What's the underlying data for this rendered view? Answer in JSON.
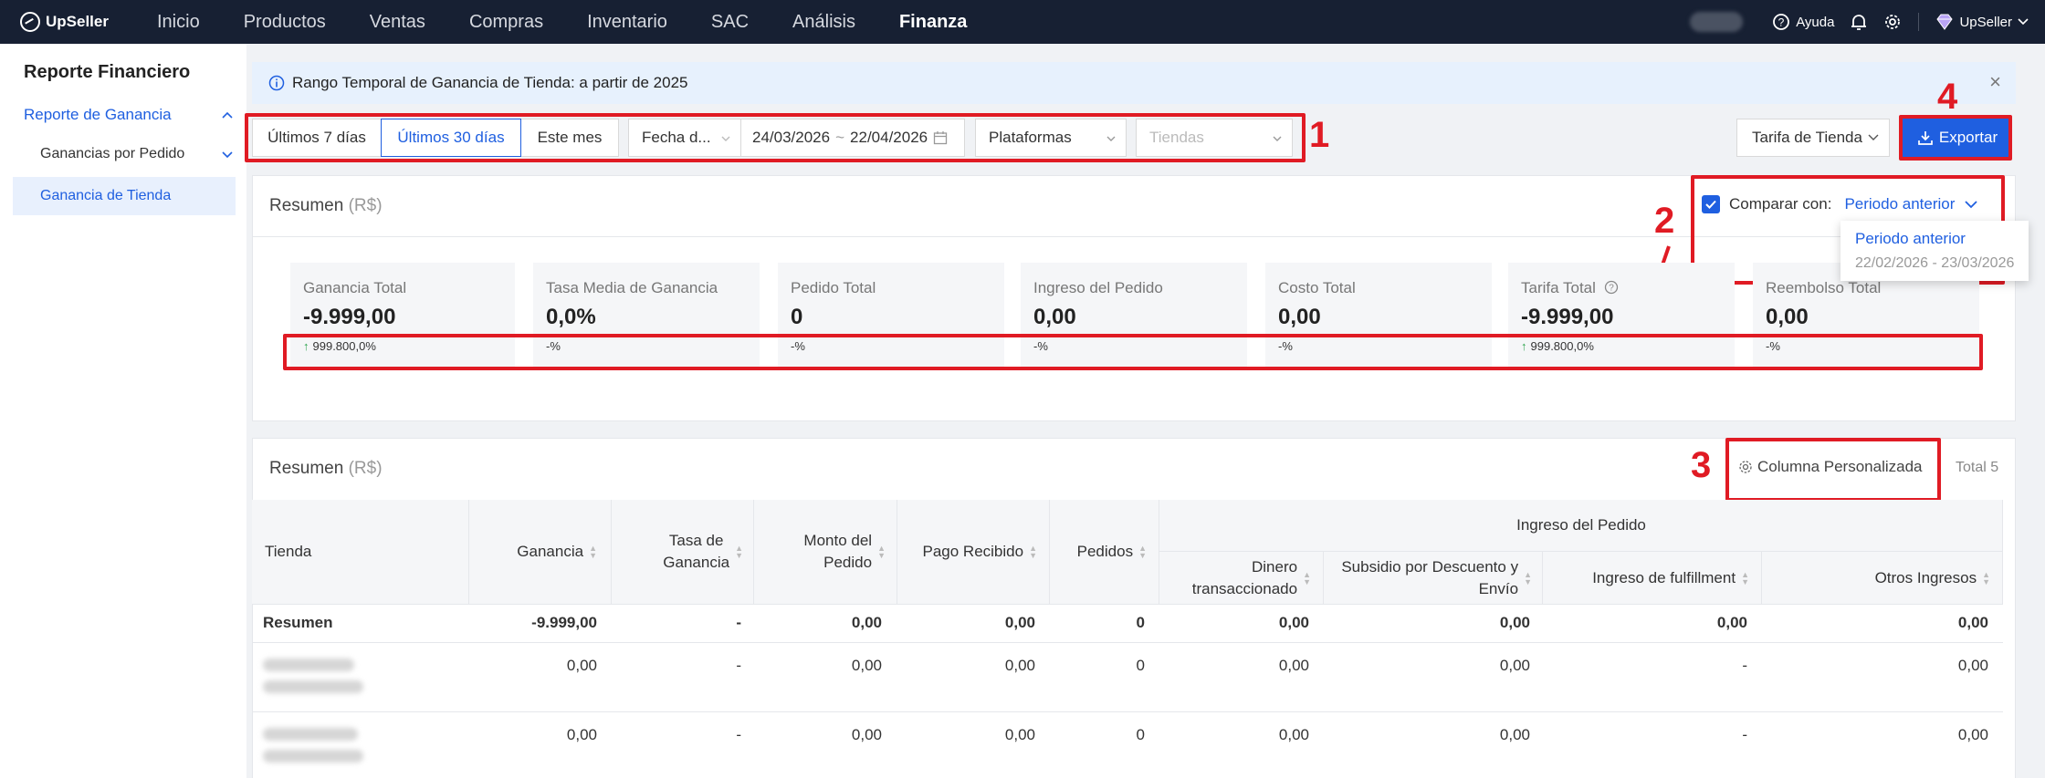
{
  "nav": {
    "brand": "UpSeller",
    "items": [
      "Inicio",
      "Productos",
      "Ventas",
      "Compras",
      "Inventario",
      "SAC",
      "Análisis",
      "Finanza"
    ],
    "active_index": 7,
    "help": "Ayuda",
    "user": "UpSeller"
  },
  "sidebar": {
    "title": "Reporte Financiero",
    "group": "Reporte de Ganancia",
    "sub_item": "Ganancias por Pedido",
    "active_item": "Ganancia de Tienda"
  },
  "banner": {
    "text": "Rango Temporal de Ganancia de Tienda: a partir de 2025"
  },
  "filters": {
    "range_7": "Últimos 7 días",
    "range_30": "Últimos 30 días",
    "this_month": "Este mes",
    "date_type": "Fecha d...",
    "date_start": "24/03/2026",
    "date_tilde": "~",
    "date_end": "22/04/2026",
    "platforms": "Plataformas",
    "stores_placeholder": "Tiendas"
  },
  "actions": {
    "tarifa": "Tarifa de Tienda",
    "export": "Exportar"
  },
  "annotations": {
    "n1": "1",
    "n2": "2",
    "n3": "3",
    "n4": "4"
  },
  "summary": {
    "title": "Resumen",
    "currency": "(R$)",
    "compare_label": "Comparar con:",
    "compare_value": "Periodo anterior",
    "dropdown_option": "Periodo anterior",
    "dropdown_range": "22/02/2026 - 23/03/2026",
    "metrics": [
      {
        "label": "Ganancia Total",
        "value": "-9.999,00",
        "change": "999.800,0%",
        "up": true
      },
      {
        "label": "Tasa Media de Ganancia",
        "value": "0,0%",
        "change": "-%",
        "up": false
      },
      {
        "label": "Pedido Total",
        "value": "0",
        "change": "-%",
        "up": false
      },
      {
        "label": "Ingreso del Pedido",
        "value": "0,00",
        "change": "-%",
        "up": false
      },
      {
        "label": "Costo Total",
        "value": "0,00",
        "change": "-%",
        "up": false
      },
      {
        "label": "Tarifa Total",
        "value": "-9.999,00",
        "change": "999.800,0%",
        "up": true
      },
      {
        "label": "Reembolso Total",
        "value": "0,00",
        "change": "-%",
        "up": false
      }
    ]
  },
  "table_section": {
    "title": "Resumen",
    "currency": "(R$)",
    "custom_columns": "Columna Personalizada",
    "total": "Total 5",
    "headers": {
      "tienda": "Tienda",
      "ganancia": "Ganancia",
      "tasa_1": "Tasa de",
      "tasa_2": "Ganancia",
      "monto_1": "Monto del",
      "monto_2": "Pedido",
      "pago": "Pago Recibido",
      "pedidos": "Pedidos",
      "group": "Ingreso del Pedido",
      "dinero_1": "Dinero",
      "dinero_2": "transaccionado",
      "subsidio_1": "Subsidio por Descuento y",
      "subsidio_2": "Envío",
      "fulfillment": "Ingreso de fulfillment",
      "otros": "Otros Ingresos"
    },
    "summary_row": [
      "Resumen",
      "-9.999,00",
      "-",
      "0,00",
      "0,00",
      "0",
      "0,00",
      "0,00",
      "0,00",
      "0,00"
    ],
    "rows": [
      [
        "",
        "0,00",
        "-",
        "0,00",
        "0,00",
        "0",
        "0,00",
        "0,00",
        "-",
        "0,00"
      ],
      [
        "",
        "0,00",
        "-",
        "0,00",
        "0,00",
        "0",
        "0,00",
        "0,00",
        "-",
        "0,00"
      ]
    ]
  }
}
